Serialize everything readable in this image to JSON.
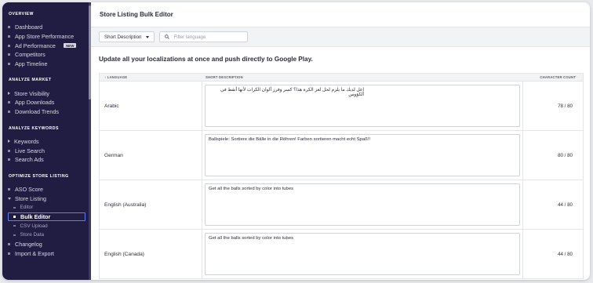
{
  "sidebar": {
    "sections": [
      {
        "title": "OVERVIEW",
        "items": [
          {
            "label": "Dashboard"
          },
          {
            "label": "App Store Performance"
          },
          {
            "label": "Ad Performance",
            "badge": "NEW"
          },
          {
            "label": "Competitors"
          },
          {
            "label": "App Timeline"
          }
        ]
      },
      {
        "title": "ANALYZE MARKET",
        "items": [
          {
            "label": "Store Visibility"
          },
          {
            "label": "App Downloads"
          },
          {
            "label": "Download Trends"
          }
        ]
      },
      {
        "title": "ANALYZE KEYWORDS",
        "items": [
          {
            "label": "Keywords"
          },
          {
            "label": "Live Search"
          },
          {
            "label": "Search Ads"
          }
        ]
      },
      {
        "title": "OPTIMIZE STORE LISTING",
        "items": [
          {
            "label": "ASO Score"
          },
          {
            "label": "Store Listing"
          },
          {
            "label": "Editor"
          },
          {
            "label": "Bulk Editor"
          },
          {
            "label": "CSV Upload"
          },
          {
            "label": "Store Data"
          },
          {
            "label": "Changelog"
          },
          {
            "label": "Import & Export"
          }
        ]
      }
    ]
  },
  "header": {
    "title": "Store Listing Bulk Editor"
  },
  "toolbar": {
    "field_select": "Short Description",
    "filter_placeholder": "Filter language"
  },
  "main": {
    "subtitle": "Update all your localizations at once and push directly to Google Play."
  },
  "table": {
    "columns": [
      "LANGUAGE",
      "SHORT DESCRIPTION",
      "CHARACTER COUNT"
    ],
    "sort_indicator": "↑",
    "rows": [
      {
        "language": "Arabic",
        "description": "إعل لديك ما يلزم لحل لغز الكرة هذا؟ كسر وفرز ألوان الكرات لأنها أنقط في الكؤوس",
        "count": "78 / 80"
      },
      {
        "language": "German",
        "description": "Ballspiele: Sortiere die Bälle in die Röhren! Farben sortieren macht echt Spaß!!",
        "count": "80 / 80"
      },
      {
        "language": "English (Australia)",
        "description": "Get all the balls sorted by color into tubes",
        "count": "44 / 80"
      },
      {
        "language": "English (Canada)",
        "description": "Get all the balls sorted by color into tubes",
        "count": "44 / 80"
      }
    ]
  },
  "colors": {
    "sidebar_bg": "#211c42",
    "active_outline": "#5b7bff"
  }
}
